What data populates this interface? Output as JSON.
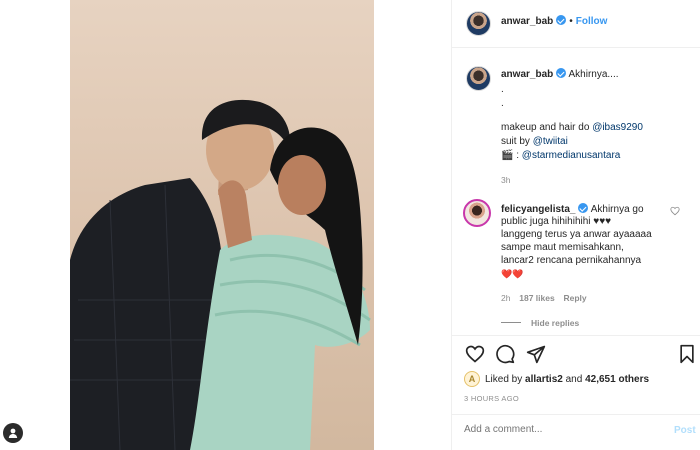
{
  "post": {
    "owner": {
      "username": "anwar_bab",
      "follow_label": "Follow",
      "separator": "•"
    },
    "caption": {
      "text": "Akhirnya....",
      "dots": [
        ".",
        "."
      ],
      "credit_prefix": "makeup and hair do",
      "makeup_mention": "@ibas9290",
      "suit_prefix": "suit by",
      "suit_mention": "@twiitai",
      "camera_emoji": "🎬",
      "camera_colon": ":",
      "studio_mention": "@starmedianusantara",
      "time": "3h"
    },
    "comment": {
      "username": "felicyangelista_",
      "lines": [
        "Akhirnya go",
        "public juga hihihihihi ♥♥♥",
        "langgeng terus ya anwar ayaaaaa",
        "sampe maut memisahkann,",
        "lancar2 rencana pernikahannya",
        "❤️❤️"
      ],
      "time": "2h",
      "likes": "187 likes",
      "reply_label": "Reply",
      "hide_replies_label": "Hide replies"
    },
    "likes": {
      "prefix": "Liked by",
      "liker": "allartis2",
      "middle": "and",
      "count": "42,651 others",
      "liker_avatar_letter": "A"
    },
    "timestamp": "3 HOURS AGO",
    "comment_box": {
      "placeholder": "Add a comment...",
      "post_label": "Post"
    },
    "icons": {
      "like": "heart-icon",
      "comment": "comment-icon",
      "share": "share-icon",
      "save": "bookmark-icon",
      "comment_like": "small-heart-icon",
      "user": "user-icon"
    },
    "colors": {
      "link_blue": "#3897f0",
      "mention": "#00376b",
      "muted": "#8e8e8e",
      "post_disabled": "#b2dffc"
    }
  }
}
